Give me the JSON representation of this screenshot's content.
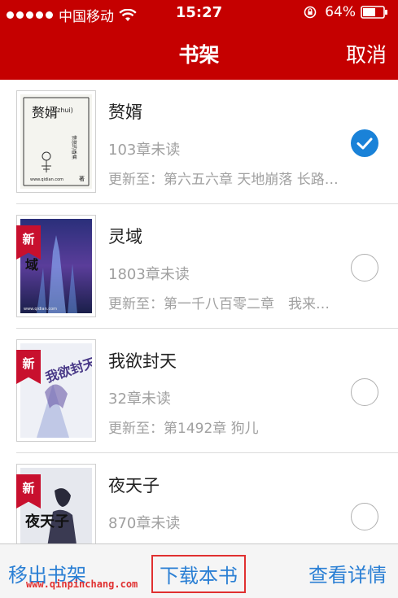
{
  "status_bar": {
    "carrier": "中国移动",
    "time": "15:27",
    "battery": "64%"
  },
  "nav": {
    "title": "书架",
    "cancel_label": "取消"
  },
  "books": [
    {
      "title": "赘婿",
      "unread": "103章未读",
      "update": "更新至：第六五六章 天地崩落 长路…",
      "is_new": false,
      "selected": true,
      "cover_text": {
        "title": "赘婿",
        "pinyin": "(zhui)",
        "subtitle": "愤怒的香蕉",
        "author_mark": "著",
        "site": "www.qidian.com"
      }
    },
    {
      "title": "灵域",
      "unread": "1803章未读",
      "update": "更新至：第一千八百零二章　我来…",
      "is_new": true,
      "selected": false,
      "cover_text": {
        "title": "域",
        "site": "www.qidian.com"
      }
    },
    {
      "title": "我欲封天",
      "unread": "32章未读",
      "update": "更新至：第1492章 狗儿",
      "is_new": true,
      "selected": false,
      "cover_text": {
        "title": "我欲封天"
      }
    },
    {
      "title": "夜天子",
      "unread": "870章未读",
      "update": "",
      "is_new": true,
      "selected": false,
      "cover_text": {
        "title": "夜天子"
      }
    }
  ],
  "new_badge": "新",
  "bottom_bar": {
    "remove_label": "移出书架",
    "download_label": "下载本书",
    "details_label": "查看详情"
  },
  "watermark": "www.qinpinchang.com",
  "colors": {
    "header_red": "#c50000",
    "accent_blue": "#1a82d8",
    "ribbon_red": "#c8102e",
    "highlight_border": "#e03030"
  }
}
